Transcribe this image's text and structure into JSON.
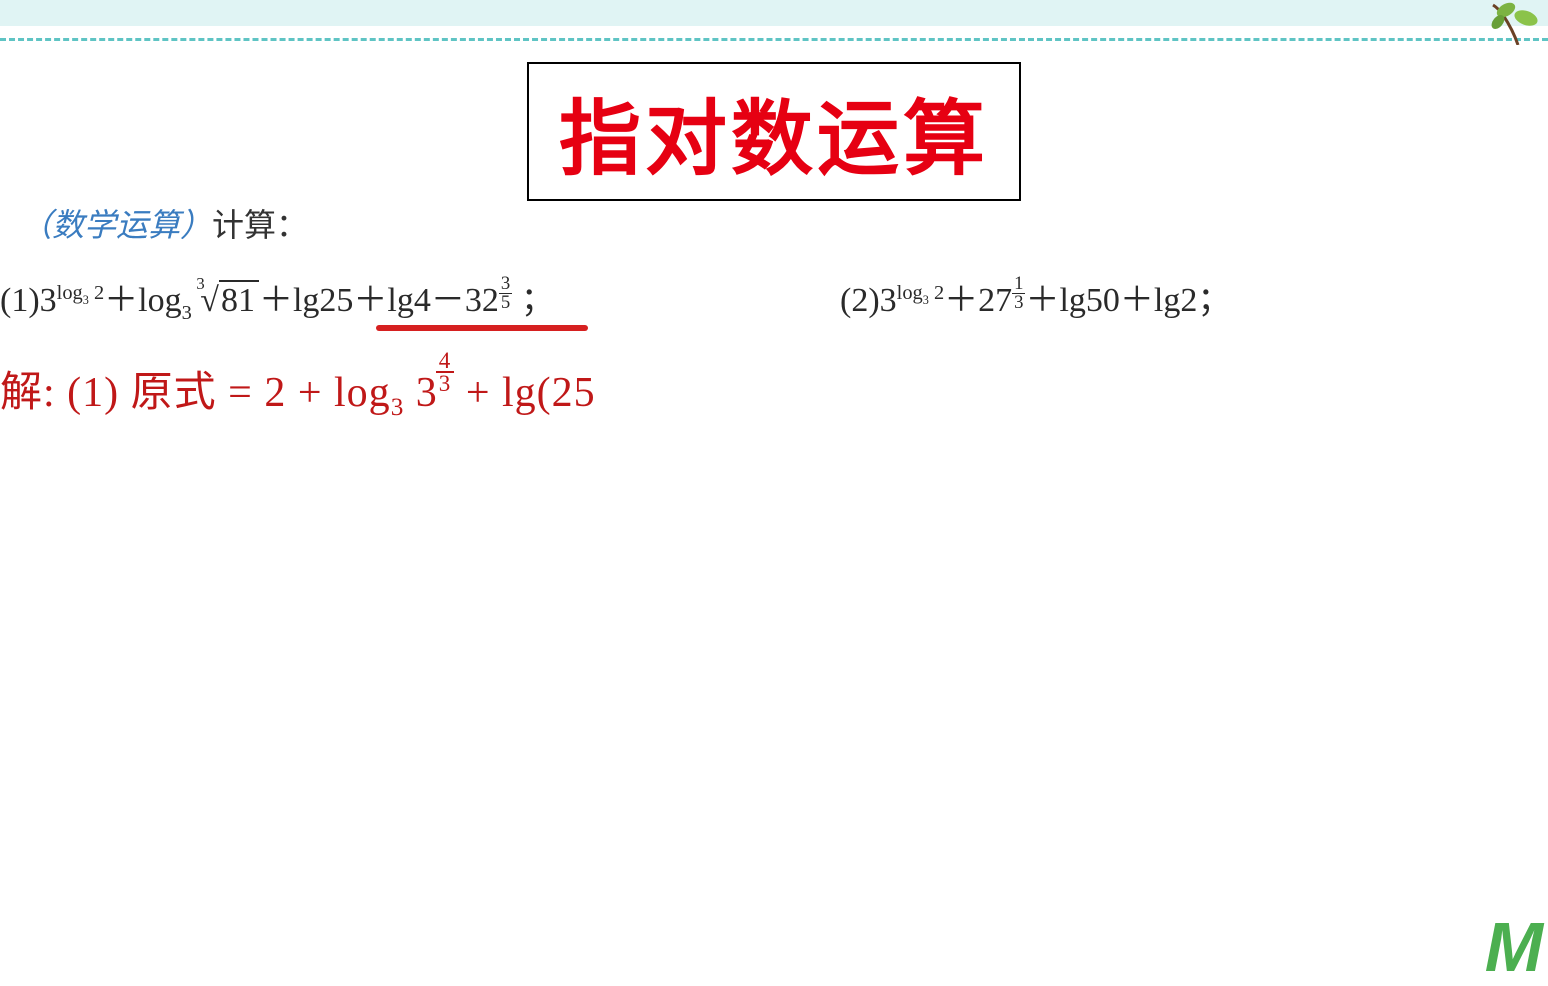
{
  "title": "指对数运算",
  "subtitle": {
    "category": "（数学运算）",
    "action": "计算："
  },
  "problems": {
    "p1": {
      "label": "(1)",
      "expr_parts": {
        "three": "3",
        "log_sub": "log",
        "log_base": "3",
        "log_arg": " 2",
        "plus1": "＋log",
        "sub3": "3",
        "space": " ",
        "root_idx": "3",
        "root_sym": "√",
        "root_body": "81",
        "plus2": "＋lg25＋lg4－32",
        "frac_top": "3",
        "frac_bot": "5",
        "semicolon": " ；"
      }
    },
    "p2": {
      "label": "(2)",
      "expr_parts": {
        "three": "3",
        "log_sub": "log",
        "log_base": "3",
        "log_arg": " 2",
        "plus1": "＋27",
        "frac_top": "1",
        "frac_bot": "3",
        "plus2": "＋lg50＋lg2；"
      }
    }
  },
  "handwriting": {
    "prefix": "解: (1) 原式 = 2 + log",
    "sub": "3",
    "base": " 3",
    "frac_top": "4",
    "frac_bot": "3",
    "suffix": " + lg(25"
  },
  "watermark": "M"
}
